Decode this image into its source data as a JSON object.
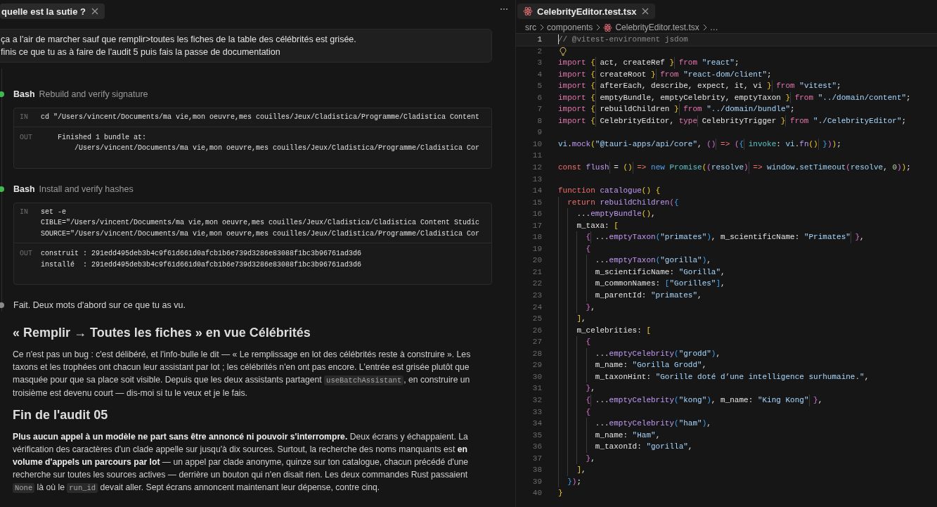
{
  "chat": {
    "tab": {
      "title": "quelle est la sutie ?"
    },
    "message": {
      "lines": [
        "ça a l'air de marcher sauf que remplir>toutes les fiches de la table des célébrités est grisée.",
        "finis ce que tu as à faire de l'audit 5 puis fais la passe de documentation"
      ]
    },
    "timeline": [
      {
        "kind": "tool",
        "color": "#3fb950",
        "tool": "Bash",
        "description": "Rebuild and verify signature",
        "input_label": "IN",
        "output_label": "OUT",
        "input": [
          "cd \"/Users/vincent/Documents/ma vie,mon oeuvre,mes couilles/Jeux/Cladistica/Programme/Cladistica Content"
        ],
        "output": [
          "    Finished 1 bundle at:",
          "        /Users/vincent/Documents/ma vie,mon oeuvre,mes couilles/Jeux/Cladistica/Programme/Cladistica Cor"
        ]
      },
      {
        "kind": "tool",
        "color": "#3fb950",
        "tool": "Bash",
        "description": "Install and verify hashes",
        "input_label": "IN",
        "output_label": "OUT",
        "input": [
          "set -e",
          "CIBLE=\"/Users/vincent/Documents/ma vie,mon oeuvre,mes couilles/Jeux/Cladistica/Cladistica Content Studic",
          "SOURCE=\"/Users/vincent/Documents/ma vie,mon oeuvre,mes couilles/Jeux/Cladistica/Programme/Cladistica Cor"
        ],
        "output": [
          "construit : 291edd495deb3b4c9f61d661d0afcb1b6e739d3286e83088f1bc3b96761ad3d6",
          "installé  : 291edd495deb3b4c9f61d661d0afcb1b6e739d3286e83088f1bc3b96761ad3d6"
        ]
      },
      {
        "kind": "text",
        "color": "#8b8b8b",
        "text": "Fait. Deux mots d'abord sur ce que tu as vu."
      }
    ],
    "document": [
      {
        "kind": "heading",
        "text": "« Remplir → Toutes les fiches » en vue Célébrités"
      },
      {
        "kind": "paragraph",
        "segments": [
          {
            "kind": "text",
            "text": "Ce n'est pas un bug : c'est délibéré, et l'info-bulle le dit — « Le remplissage en lot des célébrités reste à construire ». Les taxons et les trophées ont chacun leur assistant par lot ; les célébrités n'en ont pas encore. L'entrée est grisée plutôt que masquée pour que sa place soit visible. Depuis que les deux assistants partagent "
          },
          {
            "kind": "code",
            "text": "useBatchAssistant"
          },
          {
            "kind": "text",
            "text": ", en construire un troisième est devenu court — dis-moi si tu le veux et je le fais."
          }
        ]
      },
      {
        "kind": "heading",
        "text": "Fin de l'audit 05"
      },
      {
        "kind": "paragraph",
        "segments": [
          {
            "kind": "text",
            "text": "**Plus aucun appel à un modèle ne part sans être annoncé ni pouvoir s'interrompre.** Deux écrans y échappaient. La vérification des caractères d'un clade appelle sur jusqu'à dix sources. Surtout, la recherche des noms manquants est **en volume d'appels un parcours par lot** — un appel par clade anonyme, quinze sur ton catalogue, chacun précédé d'une recherche sur toutes les sources actives — derrière un bouton qui n'en disait rien. Les deux commandes Rust passaient "
          },
          {
            "kind": "code",
            "text": "None"
          },
          {
            "kind": "text",
            "text": " là où le "
          },
          {
            "kind": "code",
            "text": "run_id"
          },
          {
            "kind": "text",
            "text": " devait aller. Sept écrans annoncent maintenant leur dépense, contre cinq."
          }
        ]
      }
    ]
  },
  "editor": {
    "tab": {
      "title": "CelebrityEditor.test.tsx"
    },
    "breadcrumb": [
      "src",
      "components",
      "CelebrityEditor.test.tsx",
      "…"
    ],
    "lines": [
      {
        "number": "1",
        "current": true,
        "tokens": [
          {
            "kind": "cm",
            "text": "// @vitest-environment jsdom"
          }
        ]
      },
      {
        "number": "2",
        "current": false,
        "tokens": [
          {
            "kind": "bulb"
          }
        ]
      },
      {
        "number": "3",
        "current": false,
        "tokens": [
          {
            "kind": "kw",
            "text": "import "
          },
          {
            "kind": "b1",
            "text": "{"
          },
          {
            "kind": "p",
            "text": " act, createRef "
          },
          {
            "kind": "b1",
            "text": "}"
          },
          {
            "kind": "kw",
            "text": " from "
          },
          {
            "kind": "str",
            "text": "\"react\""
          },
          {
            "kind": "p",
            "text": ";"
          }
        ]
      },
      {
        "number": "4",
        "current": false,
        "tokens": [
          {
            "kind": "kw",
            "text": "import "
          },
          {
            "kind": "b1",
            "text": "{"
          },
          {
            "kind": "p",
            "text": " createRoot "
          },
          {
            "kind": "b1",
            "text": "}"
          },
          {
            "kind": "kw",
            "text": " from "
          },
          {
            "kind": "str",
            "text": "\"react-dom/client\""
          },
          {
            "kind": "p",
            "text": ";"
          }
        ]
      },
      {
        "number": "5",
        "current": false,
        "tokens": [
          {
            "kind": "kw",
            "text": "import "
          },
          {
            "kind": "b1",
            "text": "{"
          },
          {
            "kind": "p",
            "text": " afterEach, describe, expect, it, vi "
          },
          {
            "kind": "b1",
            "text": "}"
          },
          {
            "kind": "kw",
            "text": " from "
          },
          {
            "kind": "str",
            "text": "\"vitest\""
          },
          {
            "kind": "p",
            "text": ";"
          }
        ]
      },
      {
        "number": "6",
        "current": false,
        "tokens": [
          {
            "kind": "kw",
            "text": "import "
          },
          {
            "kind": "b1",
            "text": "{"
          },
          {
            "kind": "p",
            "text": " emptyBundle, emptyCelebrity, emptyTaxon "
          },
          {
            "kind": "b1",
            "text": "}"
          },
          {
            "kind": "kw",
            "text": " from "
          },
          {
            "kind": "str",
            "text": "\"../domain/content\""
          },
          {
            "kind": "p",
            "text": ";"
          }
        ]
      },
      {
        "number": "7",
        "current": false,
        "tokens": [
          {
            "kind": "kw",
            "text": "import "
          },
          {
            "kind": "b1",
            "text": "{"
          },
          {
            "kind": "p",
            "text": " rebuildChildren "
          },
          {
            "kind": "b1",
            "text": "}"
          },
          {
            "kind": "kw",
            "text": " from "
          },
          {
            "kind": "str",
            "text": "\"../domain/bundle\""
          },
          {
            "kind": "p",
            "text": ";"
          }
        ]
      },
      {
        "number": "8",
        "current": false,
        "tokens": [
          {
            "kind": "kw",
            "text": "import "
          },
          {
            "kind": "b1",
            "text": "{"
          },
          {
            "kind": "p",
            "text": " CelebrityEditor, "
          },
          {
            "kind": "kw",
            "text": "type"
          },
          {
            "kind": "p",
            "text": " CelebrityTrigger "
          },
          {
            "kind": "b1",
            "text": "}"
          },
          {
            "kind": "kw",
            "text": " from "
          },
          {
            "kind": "str",
            "text": "\"./CelebrityEditor\""
          },
          {
            "kind": "p",
            "text": ";"
          }
        ]
      },
      {
        "number": "9",
        "current": false
      },
      {
        "number": "10",
        "current": false,
        "tokens": [
          {
            "kind": "id",
            "text": "vi"
          },
          {
            "kind": "p",
            "text": "."
          },
          {
            "kind": "fn",
            "text": "mock"
          },
          {
            "kind": "b1",
            "text": "("
          },
          {
            "kind": "str",
            "text": "\"@tauri-apps/api/core\""
          },
          {
            "kind": "p",
            "text": ", "
          },
          {
            "kind": "b2",
            "text": "()"
          },
          {
            "kind": "decl",
            "text": " => "
          },
          {
            "kind": "b2",
            "text": "("
          },
          {
            "kind": "b3",
            "text": "{"
          },
          {
            "kind": "ty",
            "text": " invoke"
          },
          {
            "kind": "p",
            "text": ": "
          },
          {
            "kind": "id",
            "text": "vi"
          },
          {
            "kind": "p",
            "text": "."
          },
          {
            "kind": "fn",
            "text": "fn"
          },
          {
            "kind": "b1",
            "text": "()"
          },
          {
            "kind": "b3",
            "text": " }"
          },
          {
            "kind": "b2",
            "text": ")"
          },
          {
            "kind": "b1",
            "text": ")"
          },
          {
            "kind": "p",
            "text": ";"
          }
        ]
      },
      {
        "number": "11",
        "current": false
      },
      {
        "number": "12",
        "current": false,
        "tokens": [
          {
            "kind": "decl",
            "text": "const "
          },
          {
            "kind": "fn",
            "text": "flush"
          },
          {
            "kind": "p",
            "text": " = "
          },
          {
            "kind": "b1",
            "text": "()"
          },
          {
            "kind": "decl",
            "text": " => "
          },
          {
            "kind": "new",
            "text": "new "
          },
          {
            "kind": "ty",
            "text": "Promise"
          },
          {
            "kind": "b1",
            "text": "("
          },
          {
            "kind": "b2",
            "text": "("
          },
          {
            "kind": "id",
            "text": "resolve"
          },
          {
            "kind": "b2",
            "text": ")"
          },
          {
            "kind": "decl",
            "text": " => "
          },
          {
            "kind": "id",
            "text": "window"
          },
          {
            "kind": "p",
            "text": "."
          },
          {
            "kind": "id",
            "text": "setTimeout"
          },
          {
            "kind": "b2",
            "text": "("
          },
          {
            "kind": "id",
            "text": "resolve"
          },
          {
            "kind": "p",
            "text": ", "
          },
          {
            "kind": "num",
            "text": "0"
          },
          {
            "kind": "b2",
            "text": ")"
          },
          {
            "kind": "b1",
            "text": ")"
          },
          {
            "kind": "p",
            "text": ";"
          }
        ]
      },
      {
        "number": "13",
        "current": false
      },
      {
        "number": "14",
        "current": false,
        "tokens": [
          {
            "kind": "decl",
            "text": "function "
          },
          {
            "kind": "fn",
            "text": "catalogue"
          },
          {
            "kind": "b1",
            "text": "() {"
          }
        ]
      },
      {
        "number": "15",
        "current": false,
        "tokens": [
          {
            "kind": "decl",
            "text": "  return "
          },
          {
            "kind": "fn",
            "text": "rebuildChildren"
          },
          {
            "kind": "b2",
            "text": "("
          },
          {
            "kind": "b3",
            "text": "{"
          }
        ]
      },
      {
        "number": "16",
        "current": false,
        "tokens": [
          {
            "kind": "p",
            "text": "    ..."
          },
          {
            "kind": "fn",
            "text": "emptyBundle"
          },
          {
            "kind": "b1",
            "text": "()"
          },
          {
            "kind": "p",
            "text": ","
          }
        ]
      },
      {
        "number": "17",
        "current": false,
        "tokens": [
          {
            "kind": "p",
            "text": "    m_taxa: "
          },
          {
            "kind": "b1",
            "text": "["
          }
        ]
      },
      {
        "number": "18",
        "current": false,
        "tokens": [
          {
            "kind": "b2",
            "text": "      {"
          },
          {
            "kind": "p",
            "text": " ..."
          },
          {
            "kind": "fn",
            "text": "emptyTaxon"
          },
          {
            "kind": "b3",
            "text": "("
          },
          {
            "kind": "str",
            "text": "\"primates\""
          },
          {
            "kind": "b3",
            "text": ")"
          },
          {
            "kind": "p",
            "text": ", m_scientificName: "
          },
          {
            "kind": "str",
            "text": "\"Primates\""
          },
          {
            "kind": "b2",
            "text": " }"
          },
          {
            "kind": "p",
            "text": ","
          }
        ]
      },
      {
        "number": "19",
        "current": false,
        "tokens": [
          {
            "kind": "b2",
            "text": "      {"
          }
        ]
      },
      {
        "number": "20",
        "current": false,
        "tokens": [
          {
            "kind": "p",
            "text": "        ..."
          },
          {
            "kind": "fn",
            "text": "emptyTaxon"
          },
          {
            "kind": "b3",
            "text": "("
          },
          {
            "kind": "str",
            "text": "\"gorilla\""
          },
          {
            "kind": "b3",
            "text": ")"
          },
          {
            "kind": "p",
            "text": ","
          }
        ]
      },
      {
        "number": "21",
        "current": false,
        "tokens": [
          {
            "kind": "p",
            "text": "        m_scientificName: "
          },
          {
            "kind": "str",
            "text": "\"Gorilla\""
          },
          {
            "kind": "p",
            "text": ","
          }
        ]
      },
      {
        "number": "22",
        "current": false,
        "tokens": [
          {
            "kind": "p",
            "text": "        m_commonNames: "
          },
          {
            "kind": "b3",
            "text": "["
          },
          {
            "kind": "str",
            "text": "\"Gorilles\""
          },
          {
            "kind": "b3",
            "text": "]"
          },
          {
            "kind": "p",
            "text": ","
          }
        ]
      },
      {
        "number": "23",
        "current": false,
        "tokens": [
          {
            "kind": "p",
            "text": "        m_parentId: "
          },
          {
            "kind": "str",
            "text": "\"primates\""
          },
          {
            "kind": "p",
            "text": ","
          }
        ]
      },
      {
        "number": "24",
        "current": false,
        "tokens": [
          {
            "kind": "b2",
            "text": "      }"
          },
          {
            "kind": "p",
            "text": ","
          }
        ]
      },
      {
        "number": "25",
        "current": false,
        "tokens": [
          {
            "kind": "b1",
            "text": "    ]"
          },
          {
            "kind": "p",
            "text": ","
          }
        ]
      },
      {
        "number": "26",
        "current": false,
        "tokens": [
          {
            "kind": "p",
            "text": "    m_celebrities: "
          },
          {
            "kind": "b1",
            "text": "["
          }
        ]
      },
      {
        "number": "27",
        "current": false,
        "tokens": [
          {
            "kind": "b2",
            "text": "      {"
          }
        ]
      },
      {
        "number": "28",
        "current": false,
        "tokens": [
          {
            "kind": "p",
            "text": "        ..."
          },
          {
            "kind": "fn",
            "text": "emptyCelebrity"
          },
          {
            "kind": "b3",
            "text": "("
          },
          {
            "kind": "str",
            "text": "\"grodd\""
          },
          {
            "kind": "b3",
            "text": ")"
          },
          {
            "kind": "p",
            "text": ","
          }
        ]
      },
      {
        "number": "29",
        "current": false,
        "tokens": [
          {
            "kind": "p",
            "text": "        m_name: "
          },
          {
            "kind": "str",
            "text": "\"Gorilla Grodd\""
          },
          {
            "kind": "p",
            "text": ","
          }
        ]
      },
      {
        "number": "30",
        "current": false,
        "tokens": [
          {
            "kind": "p",
            "text": "        m_taxonHint: "
          },
          {
            "kind": "str",
            "text": "\"Gorille doté d’une intelligence surhumaine.\""
          },
          {
            "kind": "p",
            "text": ","
          }
        ]
      },
      {
        "number": "31",
        "current": false,
        "tokens": [
          {
            "kind": "b2",
            "text": "      }"
          },
          {
            "kind": "p",
            "text": ","
          }
        ]
      },
      {
        "number": "32",
        "current": false,
        "tokens": [
          {
            "kind": "b2",
            "text": "      {"
          },
          {
            "kind": "p",
            "text": " ..."
          },
          {
            "kind": "fn",
            "text": "emptyCelebrity"
          },
          {
            "kind": "b3",
            "text": "("
          },
          {
            "kind": "str",
            "text": "\"kong\""
          },
          {
            "kind": "b3",
            "text": ")"
          },
          {
            "kind": "p",
            "text": ", m_name: "
          },
          {
            "kind": "str",
            "text": "\"King Kong\""
          },
          {
            "kind": "b2",
            "text": " }"
          },
          {
            "kind": "p",
            "text": ","
          }
        ]
      },
      {
        "number": "33",
        "current": false,
        "tokens": [
          {
            "kind": "b2",
            "text": "      {"
          }
        ]
      },
      {
        "number": "34",
        "current": false,
        "tokens": [
          {
            "kind": "p",
            "text": "        ..."
          },
          {
            "kind": "fn",
            "text": "emptyCelebrity"
          },
          {
            "kind": "b3",
            "text": "("
          },
          {
            "kind": "str",
            "text": "\"ham\""
          },
          {
            "kind": "b3",
            "text": ")"
          },
          {
            "kind": "p",
            "text": ","
          }
        ]
      },
      {
        "number": "35",
        "current": false,
        "tokens": [
          {
            "kind": "p",
            "text": "        m_name: "
          },
          {
            "kind": "str",
            "text": "\"Ham\""
          },
          {
            "kind": "p",
            "text": ","
          }
        ]
      },
      {
        "number": "36",
        "current": false,
        "tokens": [
          {
            "kind": "p",
            "text": "        m_taxonId: "
          },
          {
            "kind": "str",
            "text": "\"gorilla\""
          },
          {
            "kind": "p",
            "text": ","
          }
        ]
      },
      {
        "number": "37",
        "current": false,
        "tokens": [
          {
            "kind": "b2",
            "text": "      }"
          },
          {
            "kind": "p",
            "text": ","
          }
        ]
      },
      {
        "number": "38",
        "current": false,
        "tokens": [
          {
            "kind": "b1",
            "text": "    ]"
          },
          {
            "kind": "p",
            "text": ","
          }
        ]
      },
      {
        "number": "39",
        "current": false,
        "tokens": [
          {
            "kind": "b3",
            "text": "  }"
          },
          {
            "kind": "b2",
            "text": ")"
          },
          {
            "kind": "p",
            "text": ";"
          }
        ]
      },
      {
        "number": "40",
        "current": false,
        "tokens": [
          {
            "kind": "b1",
            "text": "}"
          }
        ]
      }
    ]
  }
}
